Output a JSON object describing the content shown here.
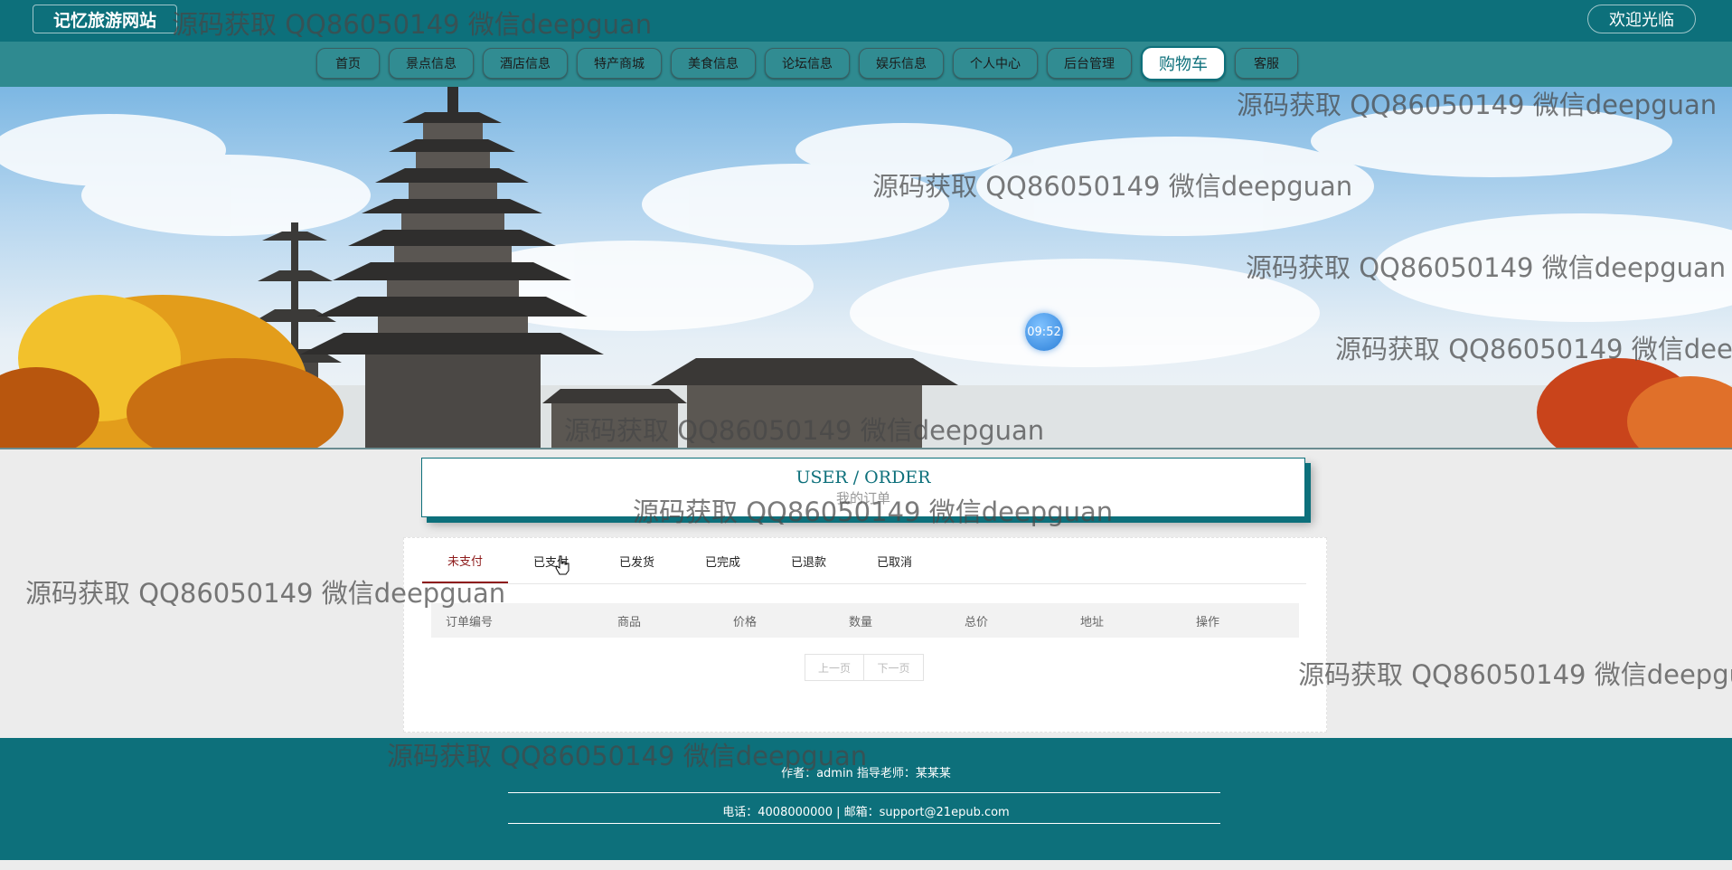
{
  "header": {
    "site_title": "记忆旅游网站",
    "welcome": "欢迎光临"
  },
  "nav": {
    "items": [
      {
        "label": "首页"
      },
      {
        "label": "景点信息"
      },
      {
        "label": "酒店信息"
      },
      {
        "label": "特产商城"
      },
      {
        "label": "美食信息"
      },
      {
        "label": "论坛信息"
      },
      {
        "label": "娱乐信息"
      },
      {
        "label": "个人中心"
      },
      {
        "label": "后台管理"
      },
      {
        "label": "购物车",
        "active": true
      },
      {
        "label": "客服"
      }
    ]
  },
  "banner": {
    "clock": "09:52"
  },
  "section": {
    "title_en": "USER / ORDER",
    "title_cn": "我的订单"
  },
  "orders": {
    "tabs": [
      {
        "label": "未支付",
        "active": true
      },
      {
        "label": "已支付"
      },
      {
        "label": "已发货"
      },
      {
        "label": "已完成"
      },
      {
        "label": "已退款"
      },
      {
        "label": "已取消"
      }
    ],
    "columns": [
      "订单编号",
      "商品",
      "价格",
      "数量",
      "总价",
      "地址",
      "操作"
    ],
    "rows": [],
    "pager": {
      "prev": "上一页",
      "next": "下一页"
    }
  },
  "footer": {
    "line1": "作者：admin 指导老师：某某某",
    "line2": "电话：4008000000 | 邮箱：support@21epub.com"
  },
  "watermark": "源码获取 QQ86050149 微信deepguan",
  "colors": {
    "primary": "#0d707b",
    "nav_bg": "#2f8a90",
    "active_tab": "#8e1c1c",
    "page_bg": "#ececec"
  }
}
